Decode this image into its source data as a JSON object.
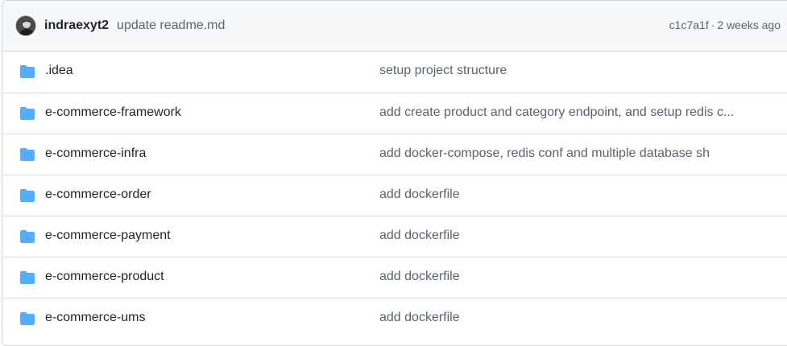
{
  "commit": {
    "author": "indraexyt2",
    "message": "update readme.md",
    "sha": "c1c7a1f",
    "separator": "·",
    "time": "2 weeks ago"
  },
  "files": [
    {
      "name": ".idea",
      "message": "setup project structure",
      "type": "folder"
    },
    {
      "name": "e-commerce-framework",
      "message": "add create product and category endpoint, and setup redis c...",
      "type": "folder"
    },
    {
      "name": "e-commerce-infra",
      "message": "add docker-compose, redis conf and multiple database sh",
      "type": "folder"
    },
    {
      "name": "e-commerce-order",
      "message": "add dockerfile",
      "type": "folder"
    },
    {
      "name": "e-commerce-payment",
      "message": "add dockerfile",
      "type": "folder"
    },
    {
      "name": "e-commerce-product",
      "message": "add dockerfile",
      "type": "folder"
    },
    {
      "name": "e-commerce-ums",
      "message": "add dockerfile",
      "type": "folder"
    }
  ],
  "colors": {
    "folder": "#54aeff",
    "header_bg": "#f6f8fa",
    "border": "#d0d7de"
  }
}
